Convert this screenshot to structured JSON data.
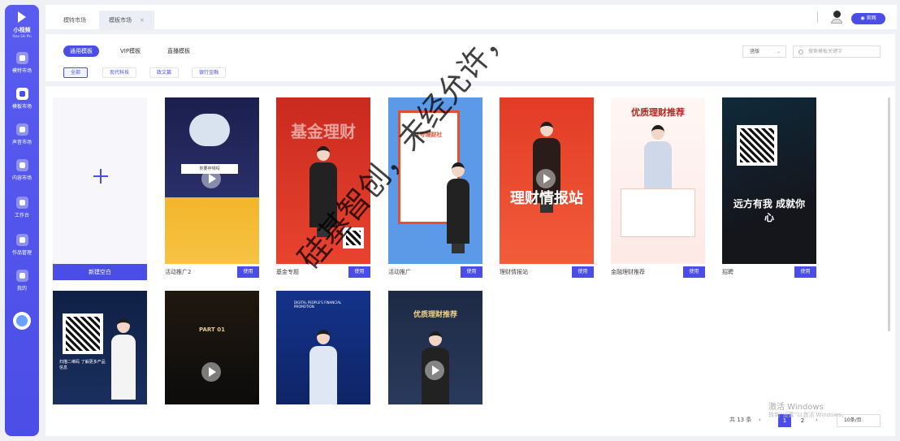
{
  "sidebar": {
    "brand": "小视频",
    "brand_sub": "Xiao Shi Pin",
    "items": [
      {
        "label": "模特市场"
      },
      {
        "label": "模板市场"
      },
      {
        "label": "声音市场"
      },
      {
        "label": "内容市场"
      },
      {
        "label": "工作台"
      },
      {
        "label": "作品管理"
      },
      {
        "label": "我的"
      }
    ]
  },
  "header": {
    "tabs": [
      {
        "label": "模特市场"
      },
      {
        "label": "模板市场",
        "close": "×"
      }
    ],
    "site_button": "官网"
  },
  "filters": {
    "main_tabs": [
      "通用模板",
      "VIP模板",
      "直播模板"
    ],
    "categories": [
      "全部",
      "现代科技",
      "政文篇",
      "银行金融"
    ],
    "orientation": "竖版",
    "search_placeholder": "搜索模板关键字"
  },
  "cards_row1": [
    {
      "label": "新建空白"
    },
    {
      "label": "活动推广2",
      "button": "使用",
      "cover_text": "你要存钱吗"
    },
    {
      "label": "基金专题",
      "button": "使用",
      "cover_text": "基金理财"
    },
    {
      "label": "活动推广",
      "button": "使用",
      "cover_text": "1号理财社"
    },
    {
      "label": "理财情报站",
      "button": "使用",
      "cover_text": "理财情报站"
    },
    {
      "label": "金融理财推荐",
      "button": "使用",
      "cover_text": "优质理财推荐"
    },
    {
      "label": "招聘",
      "button": "使用",
      "cover_text": "远方有我 成就你心"
    }
  ],
  "cards_row2": [
    {
      "cover_text": "扫描二维码 了解更多产品信息"
    },
    {
      "cover_text": "PART 01"
    },
    {
      "cover_text": "DIGITAL PEOPLE'S FINANCIAL PROMOTION"
    },
    {
      "cover_text": "优质理财推荐"
    }
  ],
  "pagination": {
    "total": "共 13 条",
    "prev": "‹",
    "pages": [
      "1",
      "2"
    ],
    "next": "›",
    "page_size": "10条/页"
  },
  "overlay": {
    "watermark": "硅基智创，未经允许，",
    "os_activate": "激活 Windows",
    "os_activate_sub": "转到“设置”以激活 Windows。"
  },
  "colors": {
    "accent": "#4b4ee6",
    "background": "#f0f1f5"
  }
}
